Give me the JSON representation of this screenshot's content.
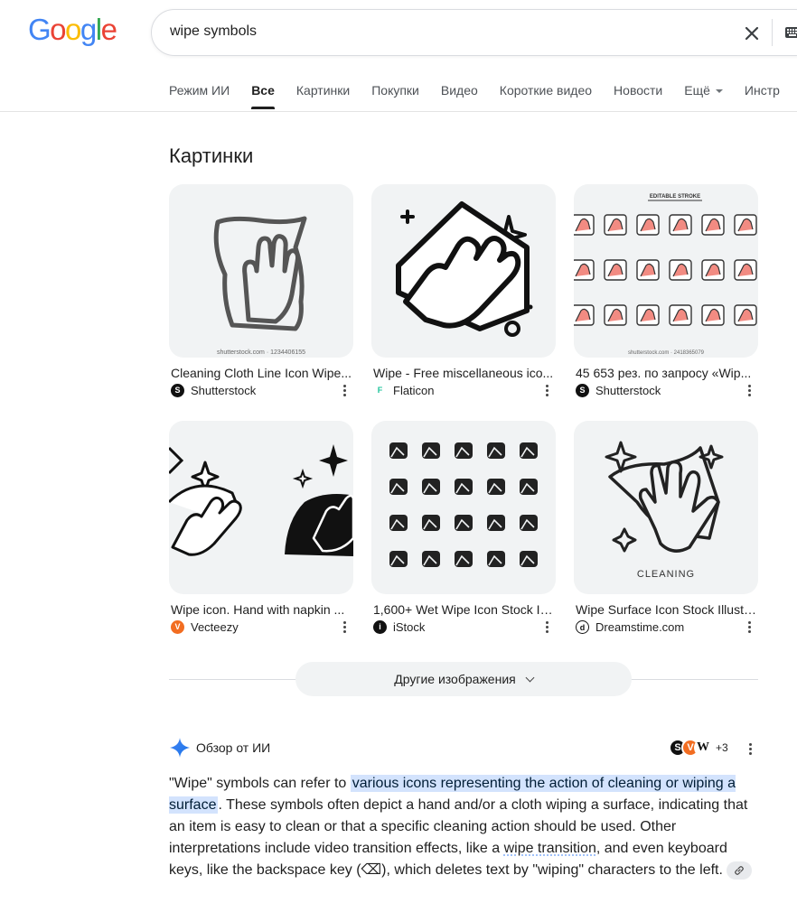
{
  "logo": {
    "letters": [
      "G",
      "o",
      "o",
      "g",
      "l",
      "e"
    ],
    "colors": [
      "#4285F4",
      "#EA4335",
      "#FBBC05",
      "#4285F4",
      "#34A853",
      "#EA4335"
    ]
  },
  "search": {
    "query": "wipe symbols"
  },
  "tabs": [
    {
      "label": "Режим ИИ",
      "active": false
    },
    {
      "label": "Все",
      "active": true
    },
    {
      "label": "Картинки",
      "active": false
    },
    {
      "label": "Покупки",
      "active": false
    },
    {
      "label": "Видео",
      "active": false
    },
    {
      "label": "Короткие видео",
      "active": false
    },
    {
      "label": "Новости",
      "active": false
    },
    {
      "label": "Ещё",
      "active": false
    },
    {
      "label": "Инстр",
      "active": false
    }
  ],
  "images_section": {
    "title": "Картинки",
    "cards": [
      {
        "caption": "Cleaning Cloth Line Icon Wipe...",
        "source": "Shutterstock",
        "favicon": "shutterstock-icon",
        "favicon_color": "#111111",
        "watermark": "shutterstock.com · 1234406155"
      },
      {
        "caption": "Wipe - Free miscellaneous ico...",
        "source": "Flaticon",
        "favicon": "flaticon-icon",
        "favicon_color": "#1dc39a"
      },
      {
        "caption": "45 653 рез. по запросу «Wip...",
        "source": "Shutterstock",
        "favicon": "shutterstock-icon",
        "favicon_color": "#111111",
        "header_text": "EDITABLE STROKE",
        "watermark": "shutterstock.com · 2418365079"
      },
      {
        "caption": "Wipe icon. Hand with napkin ...",
        "source": "Vecteezy",
        "favicon": "vecteezy-icon",
        "favicon_color": "#f26d21"
      },
      {
        "caption": "1,600+ Wet Wipe Icon Stock Ill...",
        "source": "iStock",
        "favicon": "istock-icon",
        "favicon_color": "#111111"
      },
      {
        "caption": "Wipe Surface Icon Stock Illustr...",
        "source": "Dreamstime.com",
        "favicon": "dreamstime-icon",
        "favicon_color": "#111111",
        "label": "CLEANING"
      }
    ],
    "more_button": "Другие изображения"
  },
  "ai_overview": {
    "title": "Обзор от ИИ",
    "sources_extra": "+3",
    "source_icons": [
      "shutterstock-icon",
      "vecteezy-icon",
      "wikipedia-icon"
    ],
    "text_before": "\"Wipe\" symbols can refer to ",
    "text_highlight": "various icons representing the action of cleaning or wiping a surface",
    "text_middle": ". These symbols often depict a hand and/or a cloth wiping a surface, indicating that an item is easy to clean or that a specific cleaning action should be used. Other interpretations include video transition effects, like a ",
    "text_link": "wipe transition",
    "text_after": ", and even keyboard keys, like the backspace key (⌫), which deletes text by \"wiping\" characters to the left."
  }
}
